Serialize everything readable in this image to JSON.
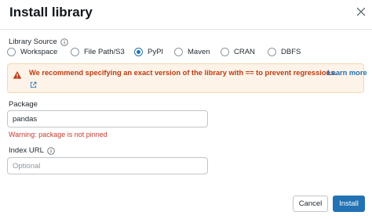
{
  "dialog": {
    "title": "Install library"
  },
  "library_source": {
    "label": "Library Source",
    "options": [
      "Workspace",
      "File Path/S3",
      "PyPI",
      "Maven",
      "CRAN",
      "DBFS"
    ],
    "selected": "PyPI"
  },
  "alert": {
    "message": "We recommend specifying an exact version of the library with == to prevent regressions.",
    "link_text": "Learn more"
  },
  "package": {
    "label": "Package",
    "value": "pandas",
    "warning": "Warning: package is not pinned"
  },
  "index_url": {
    "label": "Index URL",
    "placeholder": "Optional"
  },
  "footer": {
    "cancel_label": "Cancel",
    "install_label": "Install"
  },
  "colors": {
    "primary": "#2272b4",
    "warning_text": "#bc3b12",
    "warning_bg": "#fdf3e8",
    "error_text": "#c23a2f"
  }
}
